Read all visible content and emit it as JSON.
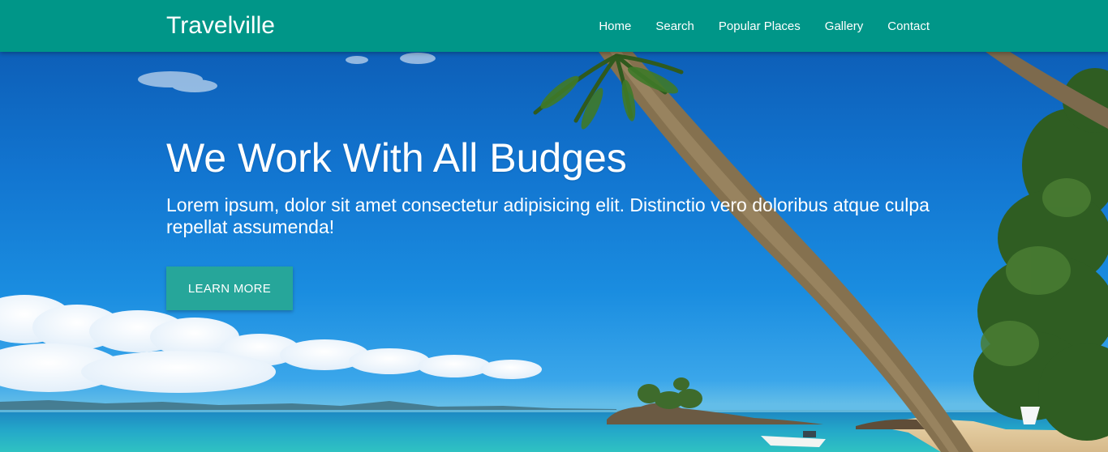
{
  "navbar": {
    "brand": "Travelville",
    "links": [
      {
        "label": "Home"
      },
      {
        "label": "Search"
      },
      {
        "label": "Popular Places"
      },
      {
        "label": "Gallery"
      },
      {
        "label": "Contact"
      }
    ]
  },
  "hero": {
    "title": "We Work With All Budges",
    "subtitle": "Lorem ipsum, dolor sit amet consectetur adipisicing elit. Distinctio vero doloribus atque culpa repellat assumenda!",
    "button_label": "LEARN MORE"
  },
  "colors": {
    "primary": "#009688",
    "button": "#26a69a",
    "text": "#ffffff"
  }
}
